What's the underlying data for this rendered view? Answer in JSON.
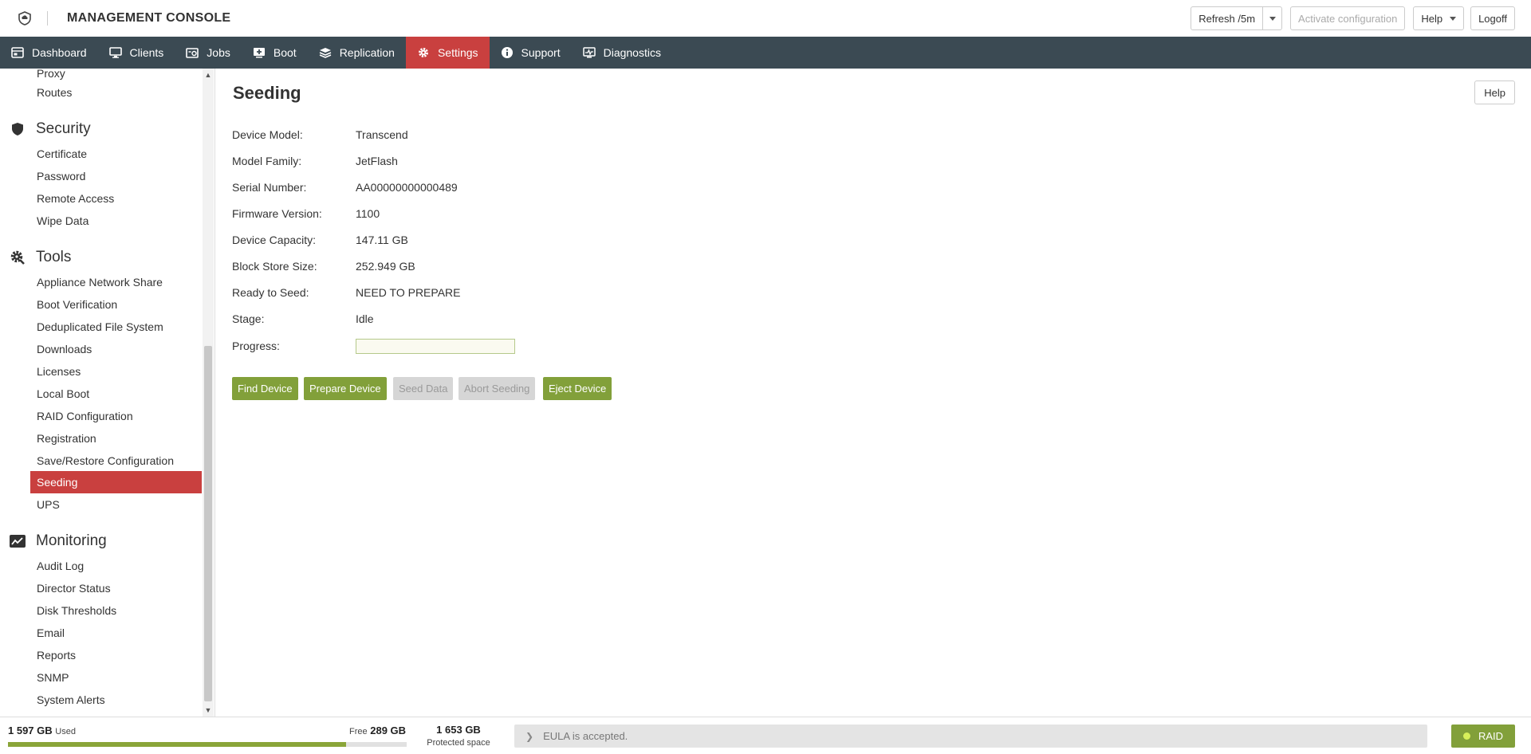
{
  "app": {
    "title": "MANAGEMENT CONSOLE",
    "logo_icon": "shield-cloud-icon"
  },
  "top_actions": {
    "refresh_label": "Refresh /5m",
    "activate_label": "Activate configuration",
    "help_label": "Help",
    "logoff_label": "Logoff"
  },
  "nav": {
    "items": [
      {
        "label": "Dashboard",
        "icon": "dashboard-icon"
      },
      {
        "label": "Clients",
        "icon": "monitor-icon"
      },
      {
        "label": "Jobs",
        "icon": "jobs-icon"
      },
      {
        "label": "Boot",
        "icon": "boot-icon"
      },
      {
        "label": "Replication",
        "icon": "replication-icon"
      },
      {
        "label": "Settings",
        "icon": "gear-icon",
        "active": true
      },
      {
        "label": "Support",
        "icon": "info-icon"
      },
      {
        "label": "Diagnostics",
        "icon": "diagnostics-icon"
      }
    ]
  },
  "sidebar": {
    "top_partial": [
      "Proxy",
      "Routes"
    ],
    "security": {
      "title": "Security",
      "icon": "shield-icon",
      "items": [
        "Certificate",
        "Password",
        "Remote Access",
        "Wipe Data"
      ]
    },
    "tools": {
      "title": "Tools",
      "icon": "tools-gear-icon",
      "items": [
        "Appliance Network Share",
        "Boot Verification",
        "Deduplicated File System",
        "Downloads",
        "Licenses",
        "Local Boot",
        "RAID Configuration",
        "Registration",
        "Save/Restore Configuration",
        "Seeding",
        "UPS"
      ],
      "active": "Seeding"
    },
    "monitoring": {
      "title": "Monitoring",
      "icon": "chart-line-icon",
      "items": [
        "Audit Log",
        "Director Status",
        "Disk Thresholds",
        "Email",
        "Reports",
        "SNMP",
        "System Alerts"
      ]
    }
  },
  "main": {
    "title": "Seeding",
    "help_label": "Help",
    "fields": [
      {
        "label": "Device Model:",
        "value": "Transcend"
      },
      {
        "label": "Model Family:",
        "value": "JetFlash"
      },
      {
        "label": "Serial Number:",
        "value": "AA00000000000489"
      },
      {
        "label": "Firmware Version:",
        "value": "1100"
      },
      {
        "label": "Device Capacity:",
        "value": "147.11 GB"
      },
      {
        "label": "Block Store Size:",
        "value": "252.949 GB"
      },
      {
        "label": "Ready to Seed:",
        "value": "NEED TO PREPARE"
      },
      {
        "label": "Stage:",
        "value": "Idle"
      }
    ],
    "progress_label": "Progress:",
    "progress_value": 0,
    "buttons": [
      {
        "label": "Find Device",
        "enabled": true
      },
      {
        "label": "Prepare Device",
        "enabled": true
      },
      {
        "label": "Seed Data",
        "enabled": false
      },
      {
        "label": "Abort Seeding",
        "enabled": false
      },
      {
        "label": "Eject Device",
        "enabled": true
      }
    ]
  },
  "footer": {
    "used_value": "1 597 GB",
    "used_label": "Used",
    "free_label": "Free",
    "free_value": "289 GB",
    "used_fraction": 0.847,
    "protected_value": "1 653 GB",
    "protected_label": "Protected space",
    "eula_text": "EULA is accepted.",
    "raid_label": "RAID"
  },
  "colors": {
    "nav_bg": "#3b4a53",
    "active_red": "#c9403f",
    "action_green": "#82a03a"
  }
}
